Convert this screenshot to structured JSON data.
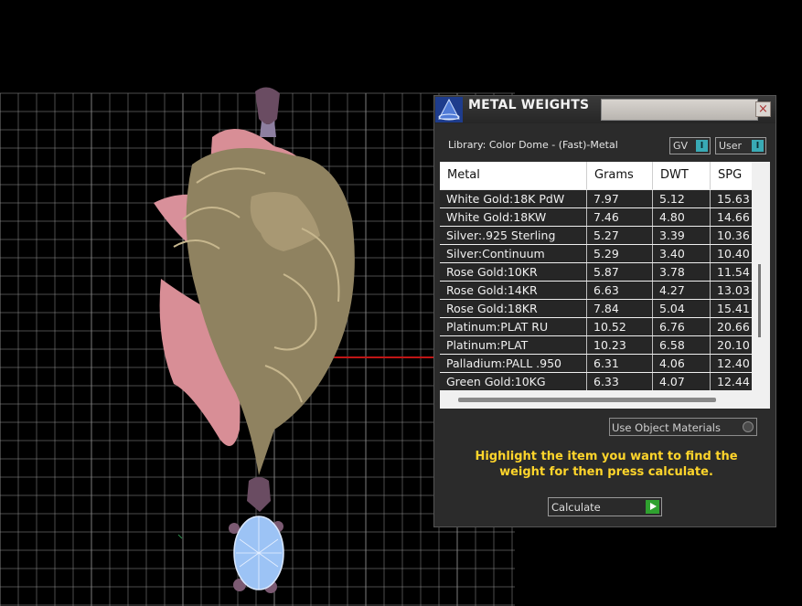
{
  "panel": {
    "title": "METAL WEIGHTS",
    "close_glyph": "×",
    "library_label": "Library: Color Dome - (Fast)-Metal",
    "toggles": [
      {
        "label": "GV",
        "glyph": "I"
      },
      {
        "label": "User",
        "glyph": "I"
      }
    ],
    "table": {
      "columns": [
        "Metal",
        "Grams",
        "DWT",
        "SPG"
      ],
      "rows": [
        [
          "White Gold:18K PdW",
          "7.97",
          "5.12",
          "15.63"
        ],
        [
          "White Gold:18KW",
          "7.46",
          "4.80",
          "14.66"
        ],
        [
          "Silver:.925 Sterling",
          "5.27",
          "3.39",
          "10.36"
        ],
        [
          "Silver:Continuum",
          "5.29",
          "3.40",
          "10.40"
        ],
        [
          "Rose Gold:10KR",
          "5.87",
          "3.78",
          "11.54"
        ],
        [
          "Rose Gold:14KR",
          "6.63",
          "4.27",
          "13.03"
        ],
        [
          "Rose Gold:18KR",
          "7.84",
          "5.04",
          "15.41"
        ],
        [
          "Platinum:PLAT RU",
          "10.52",
          "6.76",
          "20.66"
        ],
        [
          "Platinum:PLAT",
          "10.23",
          "6.58",
          "20.10"
        ],
        [
          "Palladium:PALL .950",
          "6.31",
          "4.06",
          "12.40"
        ],
        [
          "Green Gold:10KG",
          "6.33",
          "4.07",
          "12.44"
        ]
      ]
    },
    "use_object_materials": "Use Object Materials",
    "instructions": "Highlight the item you want to find the weight for then press calculate.",
    "calculate_label": "Calculate"
  },
  "colors": {
    "background": "#000000",
    "grid": "#8a8a8a",
    "model_gold": "#8f8260",
    "model_pink": "#d88e96",
    "gem_blue": "#9cc3f5",
    "highlight_text": "#ffd52b",
    "toggle_accent": "#39aab5",
    "play_green": "#2fa12f"
  },
  "icons": [
    "app-logo-icon",
    "close-icon",
    "play-icon",
    "radio-icon"
  ]
}
